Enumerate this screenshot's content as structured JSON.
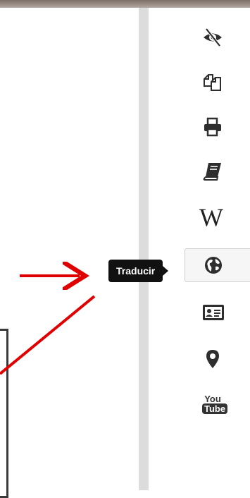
{
  "tooltip": {
    "text": "Traducir"
  },
  "toolbar": {
    "items": [
      {
        "name": "hide-icon"
      },
      {
        "name": "copy-icon"
      },
      {
        "name": "print-icon"
      },
      {
        "name": "book-icon"
      },
      {
        "name": "wikipedia-icon",
        "label": "W"
      },
      {
        "name": "globe-icon",
        "active": true
      },
      {
        "name": "contact-card-icon"
      },
      {
        "name": "map-pin-icon"
      },
      {
        "name": "youtube-icon",
        "label_top": "You",
        "label_bottom": "Tube"
      }
    ]
  },
  "colors": {
    "annotation": "#e00000",
    "icon": "#2e2e2e",
    "tooltip_bg": "#111111"
  }
}
